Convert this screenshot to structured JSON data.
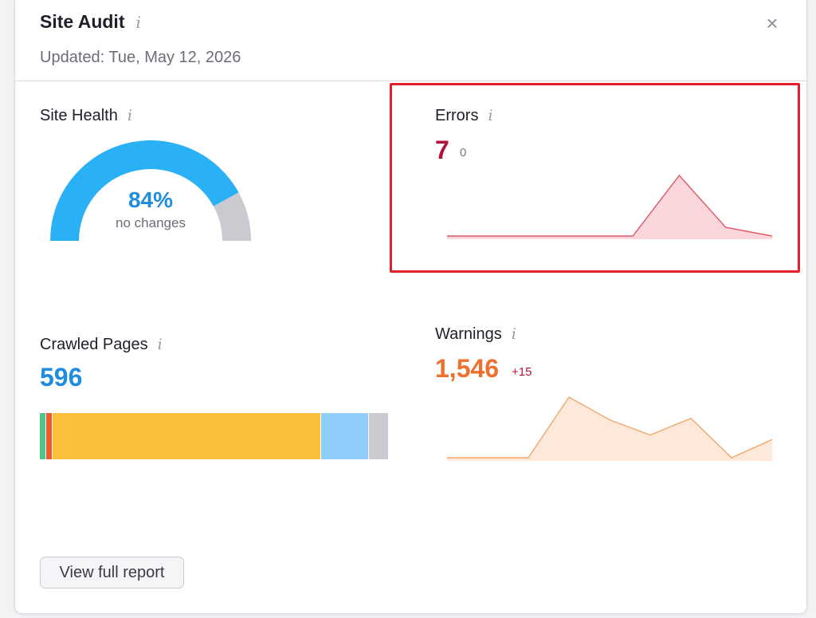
{
  "header": {
    "title": "Site Audit",
    "info_glyph": "i",
    "updated": "Updated: Tue, May 12, 2026",
    "close_glyph": "×"
  },
  "site_health": {
    "label": "Site Health",
    "value": "84%",
    "percent": 84,
    "status": "no changes",
    "color": "#2ab0f5",
    "rest_color": "#c9cbd1"
  },
  "errors": {
    "label": "Errors",
    "value": "7",
    "delta": "0",
    "value_color": "#b3133b",
    "line_color": "#e05767",
    "fill_color": "#fbd6da",
    "trend": [
      0,
      0,
      0,
      0,
      0,
      7,
      1,
      0
    ]
  },
  "crawled_pages": {
    "label": "Crawled Pages",
    "value": "596",
    "value_color": "#1f8ce0",
    "segments": [
      {
        "color": "#4cc48e",
        "value": 1.5
      },
      {
        "color": "#ec5a2b",
        "value": 1.8
      },
      {
        "color": "#fbbf3a",
        "value": 77
      },
      {
        "color": "#8fcdfb",
        "value": 13.5
      },
      {
        "color": "#c9cbd1",
        "value": 5.5
      }
    ]
  },
  "warnings": {
    "label": "Warnings",
    "value": "1,546",
    "delta": "+15",
    "value_color": "#ef6f2e",
    "delta_color": "#b3133b",
    "line_color": "#f0a86a",
    "fill_color": "#fde8da",
    "trend": [
      1300,
      1300,
      1300,
      1700,
      1550,
      1450,
      1560,
      1300,
      1420
    ]
  },
  "footer": {
    "button_label": "View full report"
  }
}
